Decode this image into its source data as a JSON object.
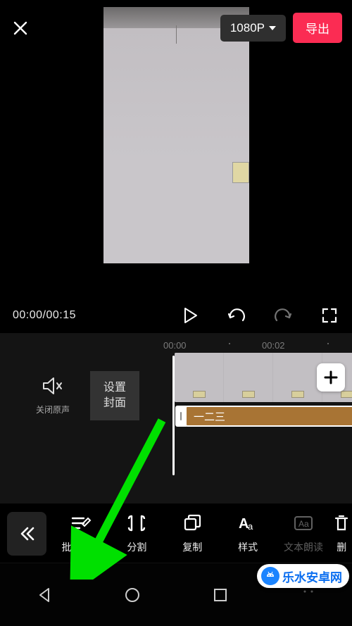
{
  "topbar": {
    "resolution_label": "1080P",
    "export_label": "导出"
  },
  "controls": {
    "currentTime": "00:00",
    "separator": "/",
    "duration": "00:15"
  },
  "ruler": {
    "ticks": [
      "00:00",
      "00:02"
    ]
  },
  "timeline": {
    "mute_label": "关闭原声",
    "cover_label": "设置\n封面",
    "text_clip": "一二三"
  },
  "tools": {
    "batch_edit": "批量编辑",
    "split": "分割",
    "copy": "复制",
    "style": "样式",
    "tts": "文本朗读",
    "delete": "删"
  },
  "brand": {
    "label": "乐水安卓网"
  }
}
